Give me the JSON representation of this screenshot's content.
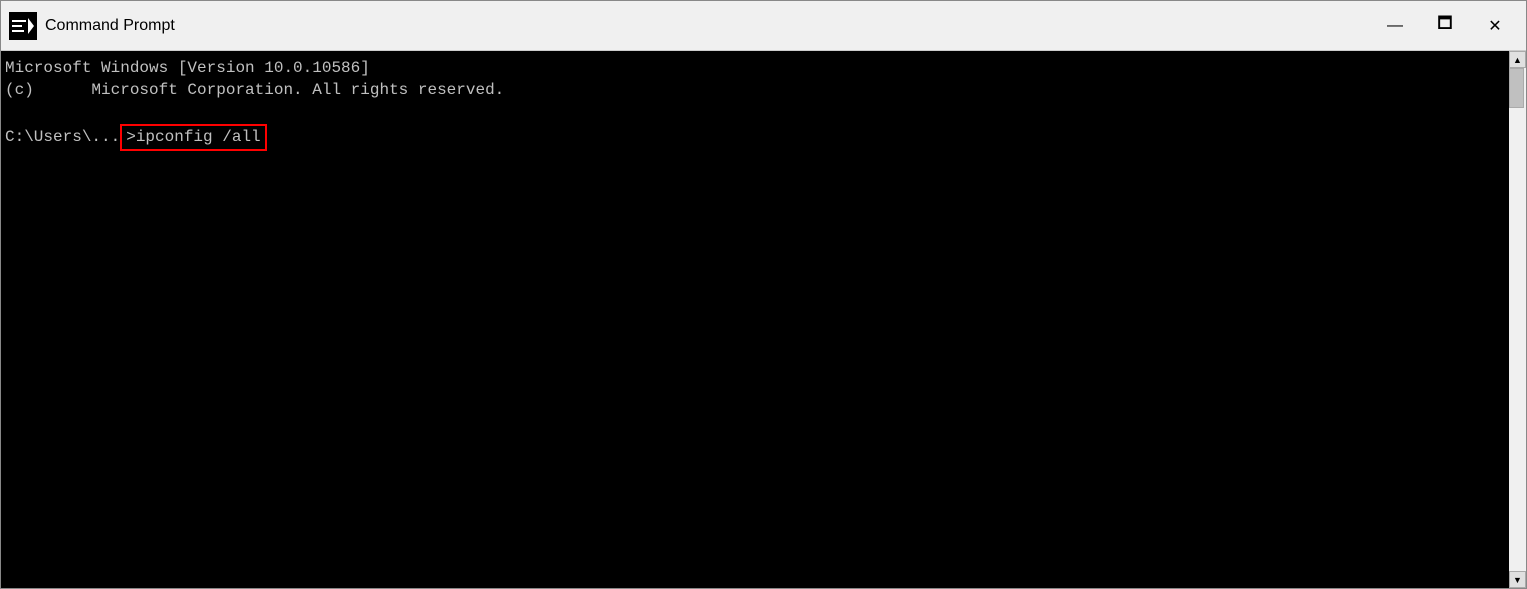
{
  "window": {
    "title": "Command Prompt",
    "icon_label": "cmd-icon"
  },
  "controls": {
    "minimize": "—",
    "maximize": "🗖",
    "close": "✕"
  },
  "terminal": {
    "line1": "Microsoft Windows [Version 10.0.10586]",
    "line2": "(c)      Microsoft Corporation. All rights reserved.",
    "line3": "",
    "prompt": "C:\\Users\\...",
    "command_highlighted": ">ipconfig /all"
  }
}
